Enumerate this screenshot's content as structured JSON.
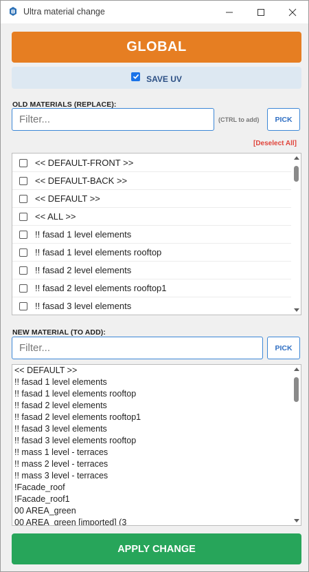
{
  "window": {
    "title": "Ultra material change",
    "icons": {
      "app": "sketchup-icon",
      "minimize": "minimize-icon",
      "maximize": "maximize-icon",
      "close": "close-icon"
    }
  },
  "global_button": {
    "label": "GLOBAL",
    "color": "#e67e22"
  },
  "save_uv": {
    "label": "SAVE UV",
    "checked": true
  },
  "old_materials": {
    "label": "OLD MATERIALS (REPLACE):",
    "filter_placeholder": "Filter...",
    "hint": "(CTRL to add)",
    "pick_label": "PICK",
    "deselect_label": "[Deselect All]",
    "items": [
      "<< DEFAULT-FRONT >>",
      "<< DEFAULT-BACK >>",
      "<< DEFAULT >>",
      "<< ALL >>",
      "!! fasad 1 level elements",
      "!! fasad 1 level elements rooftop",
      "!! fasad 2 level elements",
      "!! fasad 2 level elements rooftop1",
      "!! fasad 3 level elements"
    ]
  },
  "new_material": {
    "label": "NEW MATERIAL (TO ADD):",
    "filter_placeholder": "Filter...",
    "pick_label": "PICK",
    "items": [
      "<< DEFAULT >>",
      "!! fasad 1 level elements",
      "!! fasad 1 level elements rooftop",
      "!! fasad 2 level elements",
      "!! fasad 2 level elements rooftop1",
      "!! fasad 3 level elements",
      "!! fasad 3 level elements rooftop",
      "!! mass 1 level - terraces",
      "!! mass 2 level - terraces",
      "!! mass 3 level - terraces",
      "!Facade_roof",
      "!Facade_roof1",
      "00 AREA_green",
      "00 AREA_green [imported] (3"
    ]
  },
  "apply_button": {
    "label": "APPLY CHANGE",
    "color": "#27a55a"
  }
}
